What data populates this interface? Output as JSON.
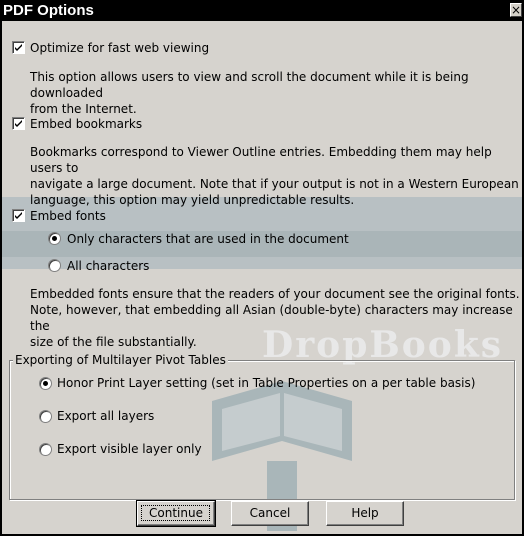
{
  "dialog": {
    "title": "PDF Options",
    "close_glyph": "×"
  },
  "options": {
    "optimize": {
      "label": "Optimize for fast web viewing",
      "checked": true,
      "description_line1": "This option allows users to view and scroll the document while it is being downloaded",
      "description_line2": "from the Internet."
    },
    "bookmarks": {
      "label": "Embed bookmarks",
      "checked": true,
      "description_line1": "Bookmarks correspond to Viewer Outline entries. Embedding them may help users to",
      "description_line2": "navigate a large document. Note that if your output is not in a Western European",
      "description_line3": "language, this option may yield unpredictable results."
    },
    "fonts": {
      "label": "Embed fonts",
      "checked": true,
      "radio_only_used": "Only characters that are used in the document",
      "radio_all": "All characters",
      "selected": "only_used",
      "description_line1": "Embedded fonts ensure that the readers of your document see the original fonts.",
      "description_line2": "Note, however, that embedding all Asian (double-byte) characters may increase the",
      "description_line3": "size of the file substantially."
    }
  },
  "pivot_tables": {
    "group_label": "Exporting of Multilayer Pivot Tables",
    "radio_honor": "Honor Print Layer setting (set in Table Properties on a per table basis)",
    "radio_all_layers": "Export all layers",
    "radio_visible": "Export visible layer only",
    "selected": "honor"
  },
  "buttons": {
    "continue": "Continue",
    "cancel": "Cancel",
    "help": "Help"
  },
  "watermark": {
    "text": "DropBooks"
  },
  "colors": {
    "face": "#d6d3ce",
    "titlebar": "#000000",
    "watermark_band": "#b8c0c3"
  }
}
